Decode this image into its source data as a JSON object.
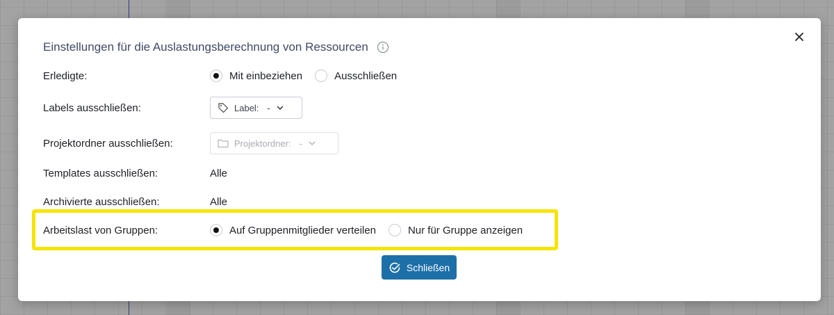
{
  "dialog": {
    "title": "Einstellungen für die Auslastungsberechnung von Ressourcen",
    "info_icon": "info-circle-icon",
    "close_icon": "close-icon"
  },
  "rows": {
    "completed": {
      "label": "Erledigte:",
      "options": [
        {
          "label": "Mit einbeziehen",
          "checked": true
        },
        {
          "label": "Ausschließen",
          "checked": false
        }
      ]
    },
    "labels": {
      "label": "Labels ausschließen:",
      "select_prefix": "Label:",
      "select_value": "-",
      "icon": "tag-icon"
    },
    "project_folder": {
      "label": "Projektordner ausschließen:",
      "select_prefix": "Projektordner:",
      "select_value": "-",
      "icon": "folder-icon",
      "disabled": true
    },
    "templates": {
      "label": "Templates ausschließen:",
      "value": "Alle"
    },
    "archived": {
      "label": "Archivierte ausschließen:",
      "value": "Alle"
    },
    "group_workload": {
      "label": "Arbeitslast von Gruppen:",
      "options": [
        {
          "label": "Auf Gruppenmitglieder verteilen",
          "checked": true
        },
        {
          "label": "Nur für Gruppe anzeigen",
          "checked": false
        }
      ]
    }
  },
  "footer": {
    "close_label": "Schließen",
    "close_icon": "check-circle-icon"
  },
  "colors": {
    "primary": "#1d6fa8",
    "highlight": "#f5e400",
    "title": "#3f4a66"
  }
}
